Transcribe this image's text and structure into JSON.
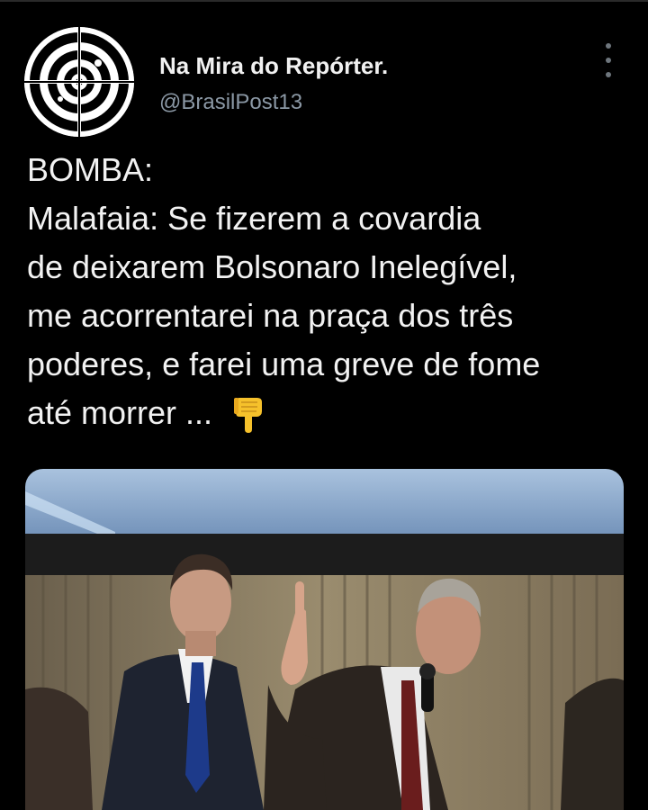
{
  "author": {
    "display_name": "Na Mira do Repórter.",
    "handle": "@BrasilPost13",
    "avatar_icon": "target-icon"
  },
  "tweet": {
    "lines": [
      "BOMBA:",
      "Malafaia: Se fizerem a covardia",
      "de deixarem Bolsonaro Inelegível,",
      "me acorrentarei na praça dos três",
      "poderes, e farei uma greve de fome",
      "até morrer ..."
    ],
    "emoji": "pointing-down-hand-emoji"
  },
  "media": {
    "type": "photo"
  },
  "colors": {
    "background": "#000000",
    "text": "#f2f2f2",
    "handle": "#8b98a5"
  }
}
